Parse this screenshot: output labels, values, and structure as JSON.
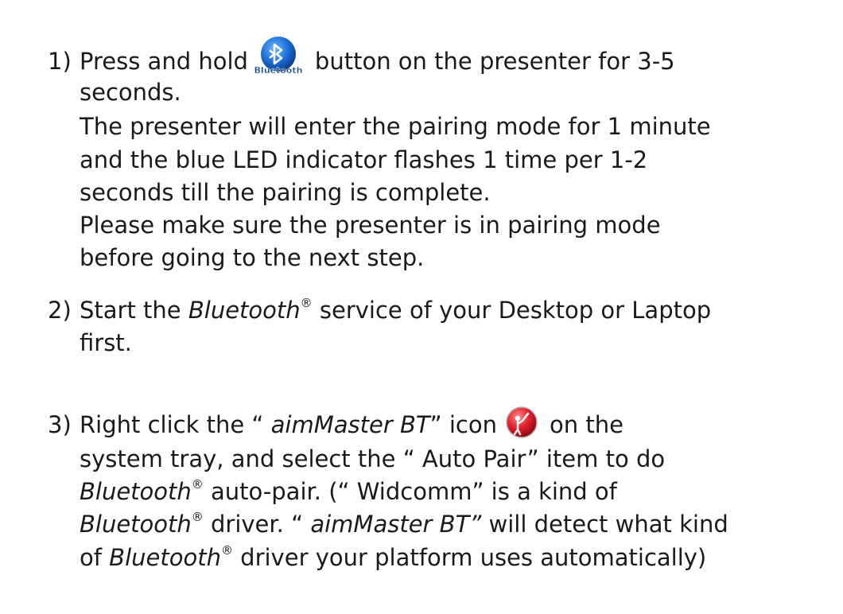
{
  "step1": {
    "num": "1)",
    "a": "Press and hold",
    "icon_text": "Bluetooth",
    "b": "button on the presenter for 3-5",
    "l2": "seconds.",
    "l3": "The presenter will enter the pairing mode for 1 minute",
    "l4": "and the blue LED indicator flashes 1 time per 1-2",
    "l5": "seconds till the pairing is complete.",
    "l6": "Please make sure the presenter is in pairing mode",
    "l7": "before going to the next step."
  },
  "step2": {
    "num": "2)",
    "a": "Start the",
    "bt": "Bluetooth",
    "reg": "®",
    "b": "service of your Desktop or Laptop",
    "l2": "first."
  },
  "step3": {
    "num": "3)",
    "a": "Right click the “",
    "app": "aimMaster BT",
    "b": "” icon",
    "c": "on the",
    "l2": "system tray, and select the “ Auto Pair” item to do",
    "l3_bt": "Bluetooth",
    "reg": "®",
    "l3_b": "auto-pair. (“ Widcomm” is a kind of",
    "l4_bt": "Bluetooth",
    "l4_b": "driver. “",
    "l4_app": "aimMaster BT”",
    "l4_c": "will detect what kind",
    "l5_a": "of",
    "l5_bt": "Bluetooth",
    "l5_b": "driver your platform uses automatically)"
  },
  "colors": {
    "text": "#1a1a1a",
    "bluetooth_blue": "#1a6fd6",
    "aim_red": "#e01e2a"
  }
}
